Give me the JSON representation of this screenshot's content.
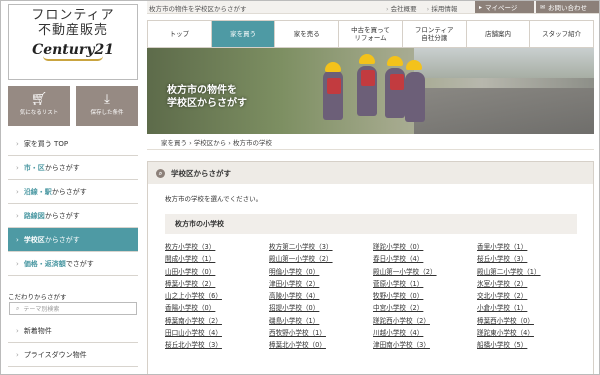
{
  "breadcrumb_top": "枚方市の物件を学校区からさがす",
  "top_links": [
    "会社概要",
    "採用情報"
  ],
  "top_buttons": [
    "マイページ",
    "お問い合わせ"
  ],
  "logo": {
    "line1": "フロンティア",
    "line2": "不動産販売",
    "brand": "Century21"
  },
  "nav": [
    {
      "label": "トップ"
    },
    {
      "label": "家を買う"
    },
    {
      "label": "家を売る"
    },
    {
      "label": "中古を買って\nリフォーム"
    },
    {
      "label": "フロンティア\n自社分譲"
    },
    {
      "label": "店舗案内"
    },
    {
      "label": "スタッフ紹介"
    }
  ],
  "hero_title_line1": "枚方市の物件を",
  "hero_title_line2": "学校区からさがす",
  "breadcrumb": "家を買う › 学校区から › 枚方市の学校",
  "sidebar": {
    "fav_label": "気になるリスト",
    "saved_label": "保存した条件",
    "items": [
      {
        "hl": "",
        "text": "家を買う TOP"
      },
      {
        "hl": "市・区",
        "text": " からさがす"
      },
      {
        "hl": "沿線・駅",
        "text": " からさがす"
      },
      {
        "hl": "路線図",
        "text": " からさがす"
      },
      {
        "hl": "学校区",
        "text": " からさがす"
      },
      {
        "hl": "価格・返済額",
        "text": " でさがす"
      }
    ],
    "kodawari_title": "こだわりからさがす",
    "search_placeholder": "テーマ別検索",
    "items2": [
      "新着物件",
      "プライスダウン物件"
    ]
  },
  "panel": {
    "title": "学校区からさがす",
    "intro": "枚方市の学校を選んでください。",
    "subtitle": "枚方市の小学校",
    "schools": [
      "枚方小学校（3）",
      "枚方第二小学校（3）",
      "蹉跎小学校（0）",
      "香里小学校（1）",
      "開成小学校（1）",
      "殿山第一小学校（2）",
      "春日小学校（4）",
      "桜丘小学校（3）",
      "山田小学校（0）",
      "明倫小学校（0）",
      "殿山第一小学校（2）",
      "殿山第二小学校（1）",
      "樟葉小学校（2）",
      "津田小学校（2）",
      "菅原小学校（1）",
      "氷室小学校（2）",
      "山之上小学校（6）",
      "高陵小学校（4）",
      "牧野小学校（0）",
      "交北小学校（2）",
      "香陽小学校（0）",
      "招提小学校（0）",
      "中宮小学校（2）",
      "小倉小学校（1）",
      "樟葉南小学校（2）",
      "磯島小学校（1）",
      "蹉跎西小学校（2）",
      "樟葉西小学校（0）",
      "田口山小学校（4）",
      "西牧野小学校（1）",
      "川越小学校（4）",
      "蹉跎東小学校（4）",
      "桜丘北小学校（3）",
      "樟葉北小学校（0）",
      "津田南小学校（3）",
      "船橋小学校（5）"
    ]
  },
  "colors": {
    "accent": "#4e9aa4",
    "button_gray": "#8c8079"
  }
}
